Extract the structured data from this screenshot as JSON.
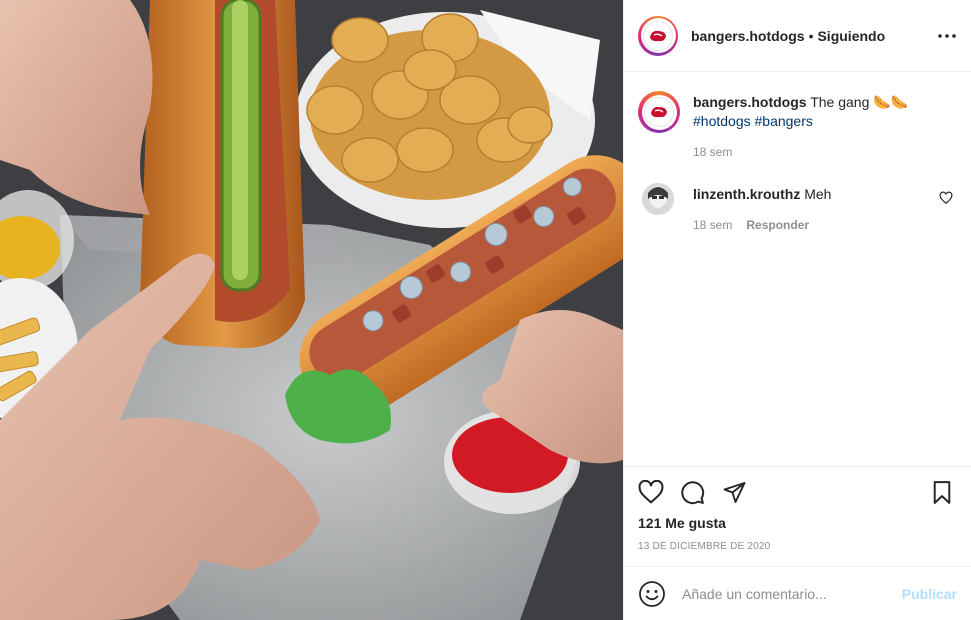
{
  "post": {
    "image_alt": "Two hot dogs on a metal tray with tater tots, fries and sauces"
  },
  "header": {
    "username": "bangers.hotdogs",
    "separator": "•",
    "follow_label": "Siguiendo",
    "more_icon": "more-horizontal-icon"
  },
  "caption": {
    "username": "bangers.hotdogs",
    "text": "The gang",
    "emoji": "🌭🌭",
    "hashtags": "#hotdogs #bangers",
    "time": "18 sem"
  },
  "comments": [
    {
      "username": "linzenth.krouthz",
      "text": "Meh",
      "time": "18 sem",
      "reply_label": "Responder"
    }
  ],
  "actions": {
    "like_icon": "heart-icon",
    "comment_icon": "comment-icon",
    "share_icon": "send-icon",
    "save_icon": "bookmark-icon"
  },
  "likes": "121 Me gusta",
  "date": "13 DE DICIEMBRE DE 2020",
  "add_comment": {
    "placeholder": "Añade un comentario...",
    "publish_label": "Publicar"
  },
  "colors": {
    "brand_red": "#c8102e",
    "hashtag": "#00376b",
    "muted": "#8e8e8e",
    "publish_disabled": "#b2dffc"
  }
}
